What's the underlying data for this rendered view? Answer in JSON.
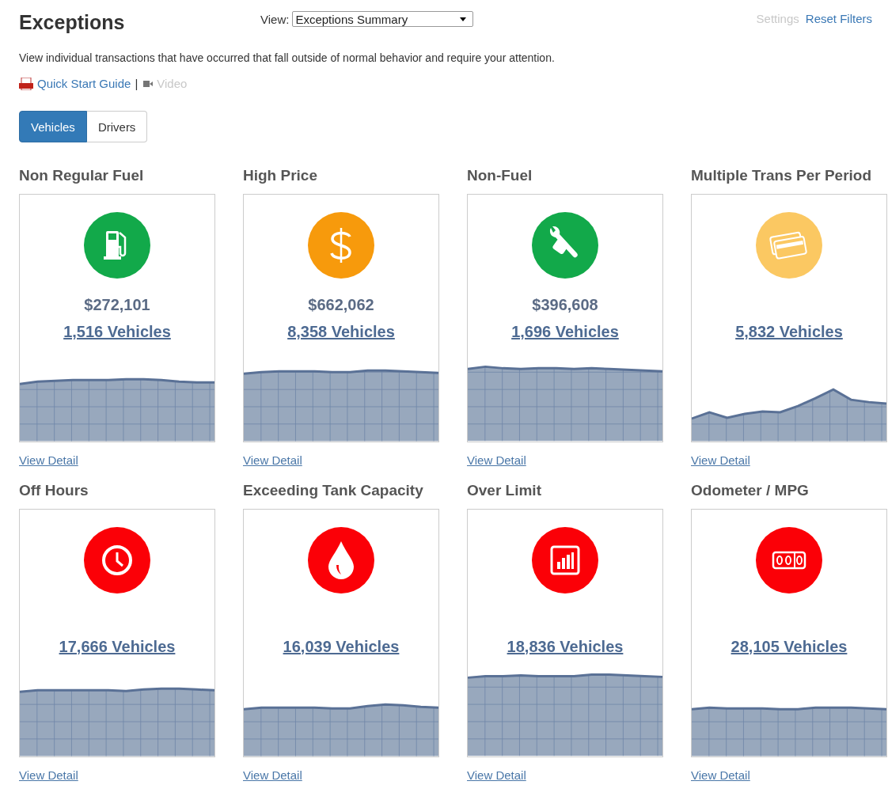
{
  "header": {
    "title": "Exceptions",
    "view_label": "View:",
    "view_select": {
      "value": "Exceptions Summary"
    },
    "links": [
      {
        "label": "Settings",
        "disabled": true
      },
      {
        "label": "Reset Filters",
        "disabled": false
      }
    ]
  },
  "description": "View individual transactions that have occurred that fall outside of normal behavior and require your attention.",
  "guides": {
    "quick_start": "Quick Start Guide",
    "separator": "|",
    "video": {
      "label": "Video",
      "disabled": true
    }
  },
  "tabs": [
    {
      "label": "Vehicles",
      "selected": true
    },
    {
      "label": "Drivers",
      "selected": false
    }
  ],
  "cards": [
    {
      "title": "Non Regular Fuel",
      "color": "#12a94a",
      "amount": "$272,101",
      "count": "1,516 Vehicles",
      "link": "View Detail"
    },
    {
      "title": "High Price",
      "color": "#f79a0c",
      "amount": "$662,062",
      "count": "8,358 Vehicles",
      "link": "View Detail"
    },
    {
      "title": "Non-Fuel",
      "color": "#12a94a",
      "amount": "$396,608",
      "count": "1,696 Vehicles",
      "link": "View Detail"
    },
    {
      "title": "Multiple Trans Per Period",
      "color": "#fbc862",
      "count": "5,832 Vehicles",
      "link": "View Detail"
    },
    {
      "title": "Off Hours",
      "color": "#fb0007",
      "count": "17,666 Vehicles",
      "link": "View Detail"
    },
    {
      "title": "Exceeding Tank Capacity",
      "color": "#fb0007",
      "count": "16,039 Vehicles",
      "link": "View Detail"
    },
    {
      "title": "Over Limit",
      "color": "#fb0007",
      "count": "18,836 Vehicles",
      "link": "View Detail"
    },
    {
      "title": "Odometer / MPG",
      "color": "#fb0007",
      "count": "28,105 Vehicles",
      "link": "View Detail"
    }
  ]
}
